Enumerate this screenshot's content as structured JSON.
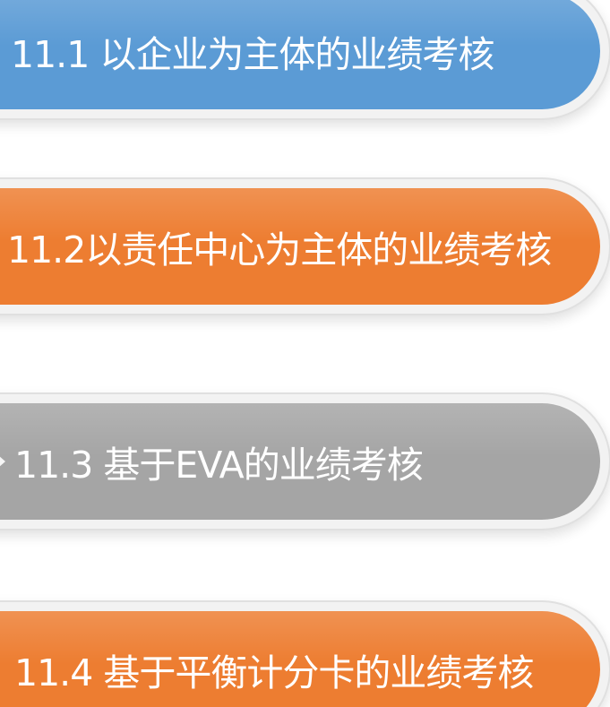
{
  "items": [
    {
      "label": "11.1 以企业为主体的业绩考核",
      "color": "#5b9bd5"
    },
    {
      "label": "11.2以责任中心为主体的业绩考核",
      "color": "#ed7d31"
    },
    {
      "label": "11.3  基于EVA的业绩考核",
      "color": "#a5a5a5"
    },
    {
      "label": "11.4 基于平衡计分卡的业绩考核",
      "color": "#ed7d31"
    }
  ]
}
